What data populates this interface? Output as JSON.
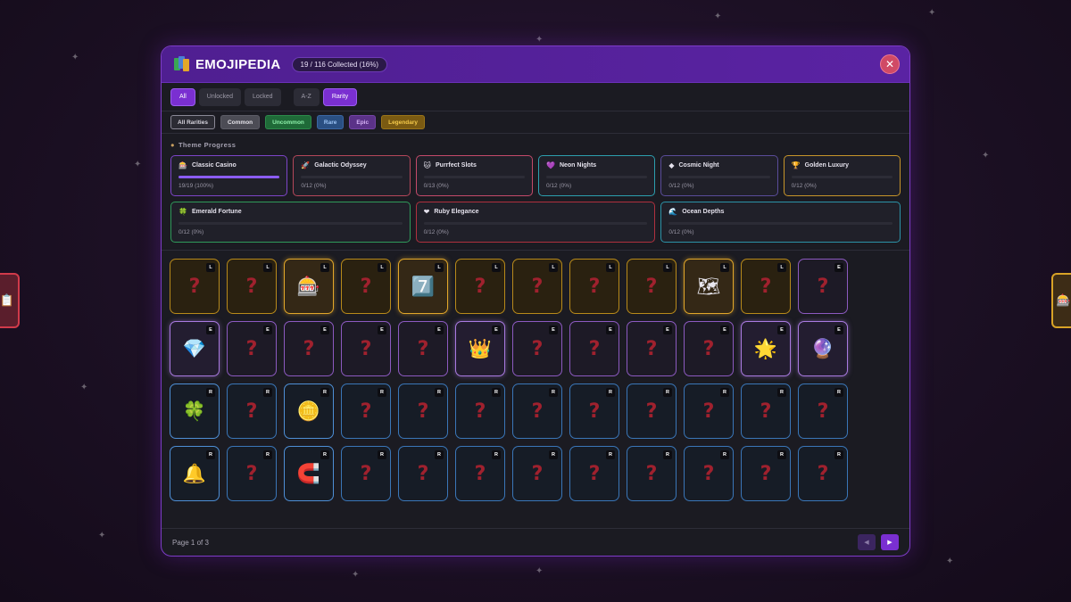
{
  "header": {
    "title": "EMOJIPEDIA",
    "collected": "19 / 116 Collected (16%)",
    "close_icon": "close-icon"
  },
  "filters": [
    {
      "label": "All",
      "active": true
    },
    {
      "label": "Unlocked",
      "active": false
    },
    {
      "label": "Locked",
      "active": false
    },
    {
      "label": "A-Z",
      "active": false
    },
    {
      "label": "Rarity",
      "active": true
    }
  ],
  "rarity_filters": [
    {
      "label": "All Rarities",
      "bg": "#2b2b33",
      "color": "#d8d6df",
      "border": "#8a8896"
    },
    {
      "label": "Common",
      "bg": "#4c4c55",
      "color": "#e3e2e8",
      "border": "#5c5c66"
    },
    {
      "label": "Uncommon",
      "bg": "#1f6a38",
      "color": "#8ef0aa",
      "border": "#2b8a4a"
    },
    {
      "label": "Rare",
      "bg": "#2a4f82",
      "color": "#9cc4f5",
      "border": "#3a66a2"
    },
    {
      "label": "Epic",
      "bg": "#5b3288",
      "color": "#d5b2f5",
      "border": "#7444a6"
    },
    {
      "label": "Legendary",
      "bg": "#7a5a12",
      "color": "#f4c94a",
      "border": "#9a7418"
    }
  ],
  "theme_progress": {
    "heading": "Theme Progress",
    "themes_top": [
      {
        "name": "Classic Casino",
        "icon": "🎰",
        "progress": "19/19 (100%)",
        "fill": 1.0,
        "border": "#7d45c8"
      },
      {
        "name": "Galactic Odyssey",
        "icon": "🚀",
        "progress": "0/12 (0%)",
        "fill": 0,
        "border": "#b5475a"
      },
      {
        "name": "Purrfect Slots",
        "icon": "🐱",
        "progress": "0/13 (0%)",
        "fill": 0,
        "border": "#c44a6a"
      },
      {
        "name": "Neon Nights",
        "icon": "💜",
        "progress": "0/12 (0%)",
        "fill": 0,
        "border": "#2c9fae"
      },
      {
        "name": "Cosmic Night",
        "icon": "◆",
        "progress": "0/12 (0%)",
        "fill": 0,
        "border": "#5a4c9a"
      },
      {
        "name": "Golden Luxury",
        "icon": "🏆",
        "progress": "0/12 (0%)",
        "fill": 0,
        "border": "#c7952a"
      }
    ],
    "themes_bottom": [
      {
        "name": "Emerald Fortune",
        "icon": "🍀",
        "progress": "0/12 (0%)",
        "fill": 0,
        "border": "#2f9a5a"
      },
      {
        "name": "Ruby Elegance",
        "icon": "❤",
        "progress": "0/12 (0%)",
        "fill": 0,
        "border": "#b0303e"
      },
      {
        "name": "Ocean Depths",
        "icon": "🌊",
        "progress": "0/12 (0%)",
        "fill": 0,
        "border": "#2c93a8"
      }
    ]
  },
  "grid": {
    "rows": [
      {
        "rarity": "L",
        "cells": [
          "?",
          "?",
          "🎰",
          "?",
          "7️⃣",
          "?",
          "?",
          "?",
          "?",
          "🗺",
          "?"
        ]
      },
      {
        "rarity": "E",
        "cells": [
          "?",
          "?",
          "?",
          "?",
          "?",
          "?",
          "?",
          "?",
          "?",
          "?",
          "?",
          "?"
        ]
      },
      {
        "rarity": "R",
        "cells": [
          "?",
          "?",
          "?",
          "?",
          "?",
          "?",
          "?",
          "?",
          "?",
          "?",
          "?",
          "?"
        ]
      },
      {
        "rarity": "R",
        "cells": [
          "?",
          "?",
          "?",
          "?",
          "?",
          "?",
          "?",
          "?",
          "?",
          "?",
          "?",
          "?"
        ]
      }
    ]
  },
  "cells": [
    [
      {
        "r": "L",
        "e": "?"
      },
      {
        "r": "L",
        "e": "?"
      },
      {
        "r": "L",
        "e": "🎰",
        "u": true
      },
      {
        "r": "L",
        "e": "?"
      },
      {
        "r": "L",
        "e": "7️⃣",
        "u": true
      },
      {
        "r": "L",
        "e": "?"
      },
      {
        "r": "L",
        "e": "?"
      },
      {
        "r": "L",
        "e": "?"
      },
      {
        "r": "L",
        "e": "?"
      },
      {
        "r": "L",
        "e": "🗺",
        "u": true
      },
      {
        "r": "L",
        "e": "?"
      },
      {
        "r": "E",
        "e": "?"
      }
    ],
    [
      {
        "r": "E",
        "e": "💎",
        "u": true
      },
      {
        "r": "E",
        "e": "?"
      },
      {
        "r": "E",
        "e": "?"
      },
      {
        "r": "E",
        "e": "?"
      },
      {
        "r": "E",
        "e": "?"
      },
      {
        "r": "E",
        "e": "👑",
        "u": true
      },
      {
        "r": "E",
        "e": "?"
      },
      {
        "r": "E",
        "e": "?"
      },
      {
        "r": "E",
        "e": "?"
      },
      {
        "r": "E",
        "e": "?"
      },
      {
        "r": "E",
        "e": "🌟",
        "u": true
      },
      {
        "r": "E",
        "e": "🔮",
        "u": true
      }
    ],
    [
      {
        "r": "R",
        "e": "🍀",
        "u": true
      },
      {
        "r": "R",
        "e": "?"
      },
      {
        "r": "R",
        "e": "🪙",
        "u": true
      },
      {
        "r": "R",
        "e": "?"
      },
      {
        "r": "R",
        "e": "?"
      },
      {
        "r": "R",
        "e": "?"
      },
      {
        "r": "R",
        "e": "?"
      },
      {
        "r": "R",
        "e": "?"
      },
      {
        "r": "R",
        "e": "?"
      },
      {
        "r": "R",
        "e": "?"
      },
      {
        "r": "R",
        "e": "?"
      },
      {
        "r": "R",
        "e": "?"
      }
    ],
    [
      {
        "r": "R",
        "e": "🔔",
        "u": true
      },
      {
        "r": "R",
        "e": "?"
      },
      {
        "r": "R",
        "e": "🧲",
        "u": true
      },
      {
        "r": "R",
        "e": "?"
      },
      {
        "r": "R",
        "e": "?"
      },
      {
        "r": "R",
        "e": "?"
      },
      {
        "r": "R",
        "e": "?"
      },
      {
        "r": "R",
        "e": "?"
      },
      {
        "r": "R",
        "e": "?"
      },
      {
        "r": "R",
        "e": "?"
      },
      {
        "r": "R",
        "e": "?"
      },
      {
        "r": "R",
        "e": "?"
      }
    ]
  ],
  "footer": {
    "page_info": "Page 1 of 3",
    "prev_icon": "◀",
    "next_icon": "▶"
  },
  "side_tabs": {
    "left_icon": "📋",
    "right_icon": "🎰"
  },
  "colors": {
    "accent": "#7a2fd1",
    "legendary": "#e2a72a",
    "epic": "#a97ae0",
    "rare": "#4e8fd6"
  }
}
